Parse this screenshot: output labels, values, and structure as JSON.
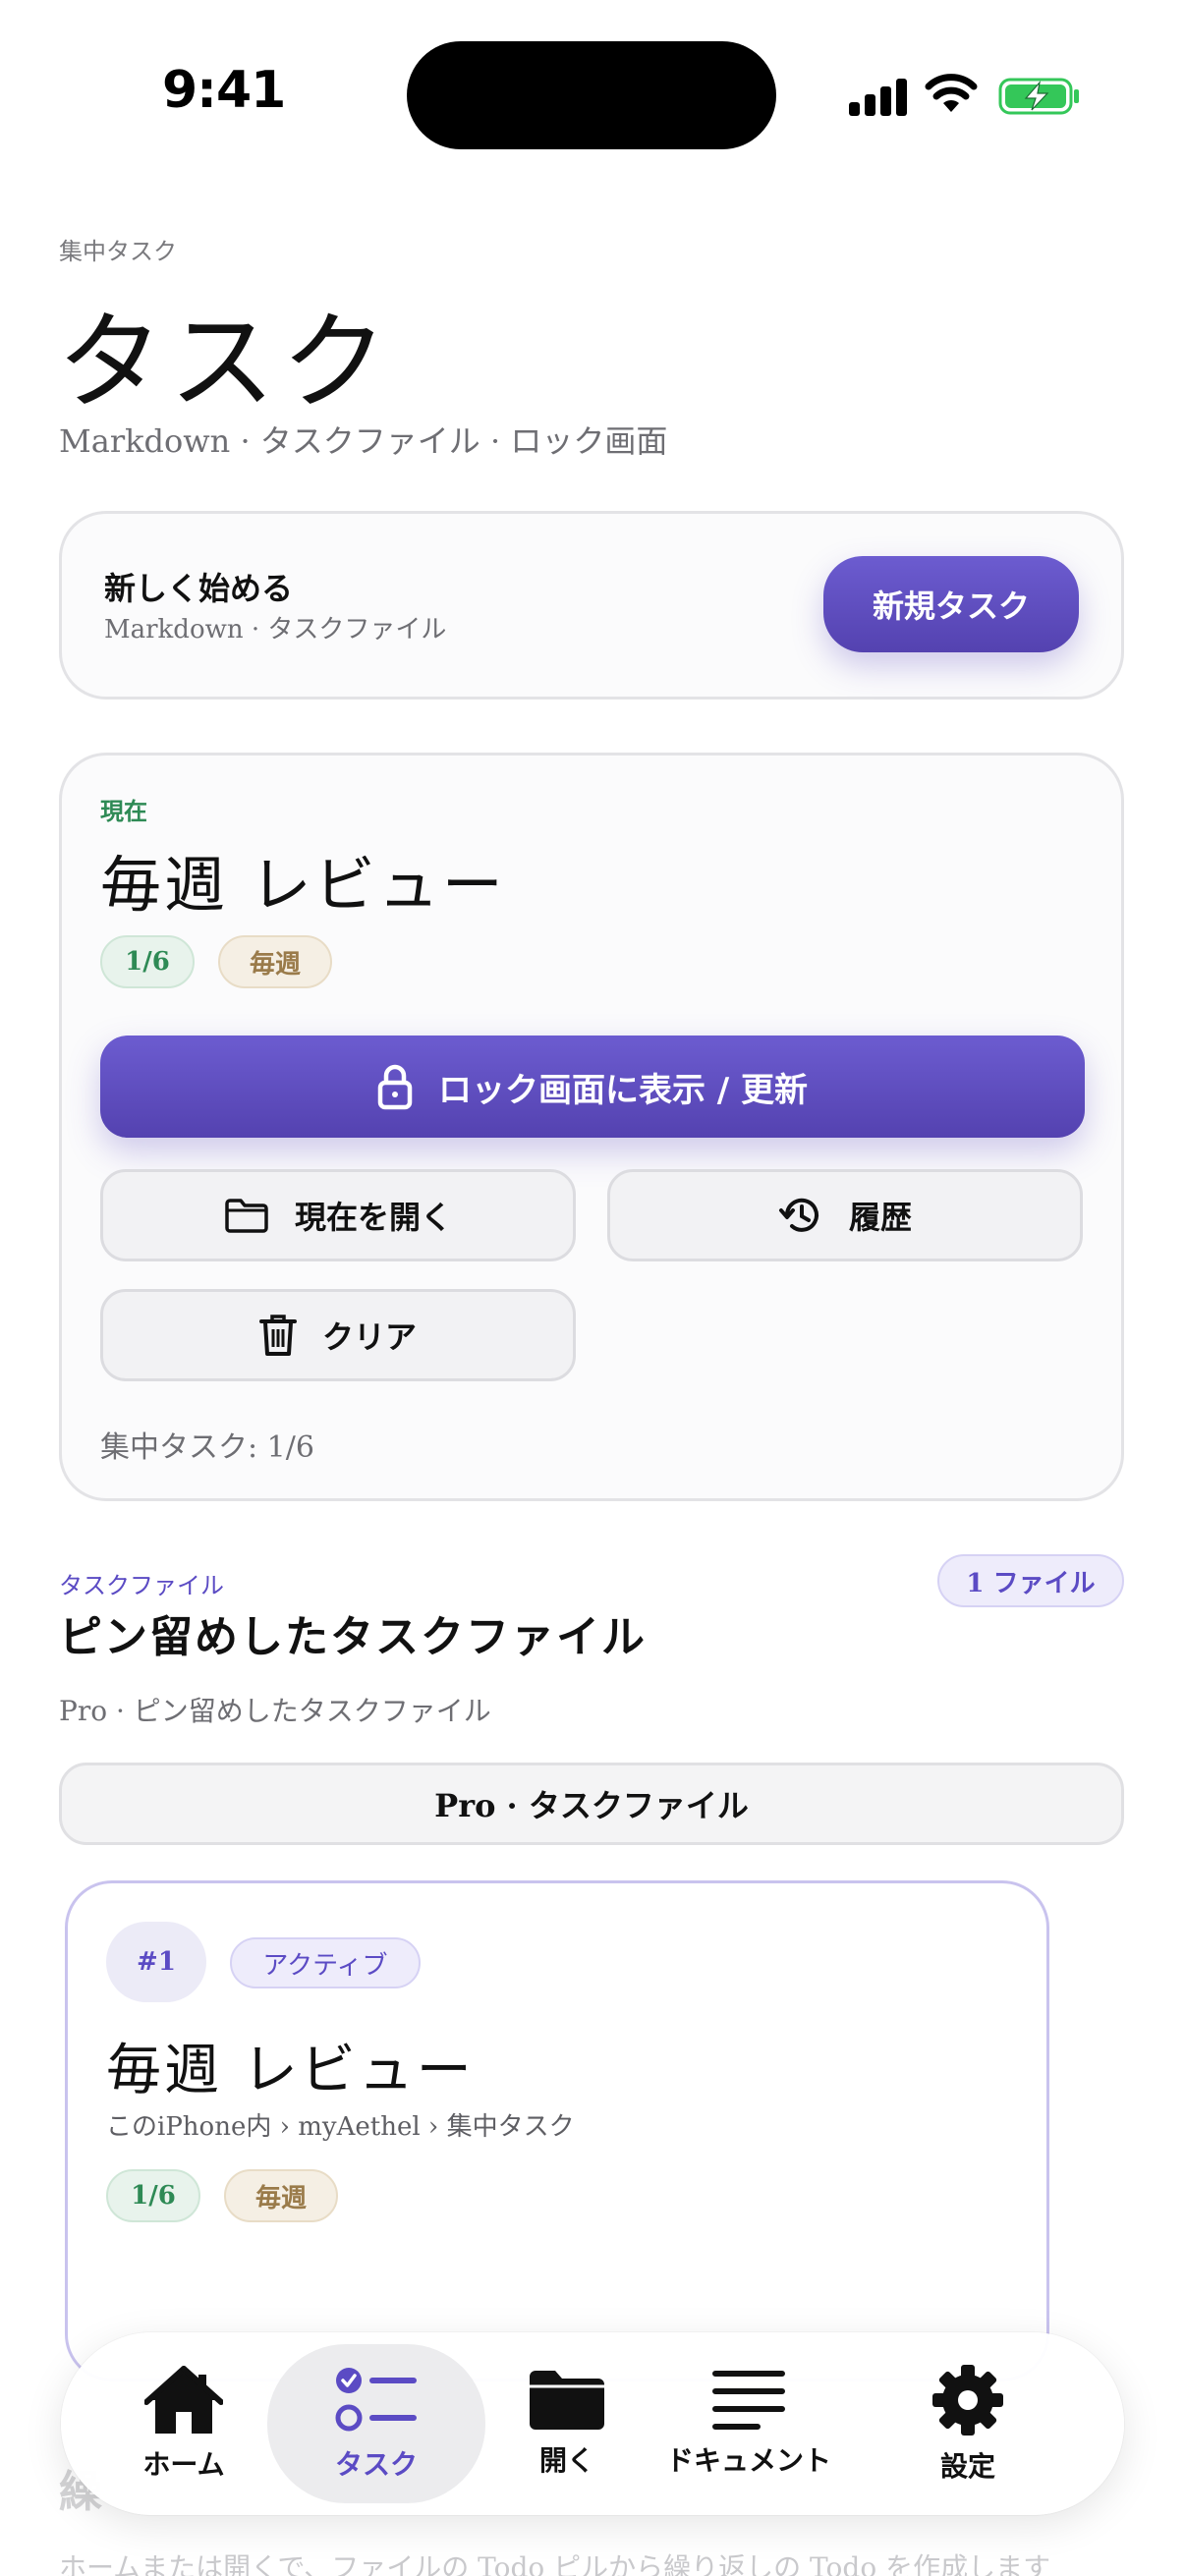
{
  "status_bar": {
    "time": "9:41"
  },
  "header": {
    "kicker": "集中タスク",
    "title": "タスク",
    "subtitle": "Markdown · タスクファイル · ロック画面"
  },
  "start_card": {
    "title": "新しく始める",
    "subtitle": "Markdown · タスクファイル",
    "new_task_button": "新規タスク"
  },
  "current": {
    "label": "現在",
    "title": "毎週 レビュー",
    "progress_badge": "1/6",
    "frequency_badge": "毎週",
    "lock_button": "ロック画面に表示 / 更新",
    "open_current_button": "現在を開く",
    "history_button": "履歴",
    "clear_button": "クリア",
    "focus_status": "集中タスク: 1/6"
  },
  "task_files": {
    "kicker": "タスクファイル",
    "count_badge": "1 ファイル",
    "title": "ピン留めしたタスクファイル",
    "subtitle": "Pro · ピン留めしたタスクファイル",
    "pro_button": "Pro · タスクファイル",
    "files": [
      {
        "number": "#1",
        "state": "アクティブ",
        "title": "毎週 レビュー",
        "path": "このiPhone内 › myAethel › 集中タスク",
        "progress": "1/6",
        "frequency": "毎週"
      }
    ]
  },
  "below": {
    "title_fragment": "繰",
    "text": "ホームまたは開くで、ファイルの Todo ピルから繰り返しの Todo を作成します"
  },
  "tab_bar": {
    "active": "tasks",
    "items": [
      {
        "id": "home",
        "label": "ホーム",
        "icon": "house-icon"
      },
      {
        "id": "tasks",
        "label": "タスク",
        "icon": "checklist-icon"
      },
      {
        "id": "open",
        "label": "開く",
        "icon": "folder-icon"
      },
      {
        "id": "documents",
        "label": "ドキュメント",
        "icon": "text-lines-icon"
      },
      {
        "id": "settings",
        "label": "設定",
        "icon": "gear-icon"
      }
    ]
  },
  "colors": {
    "accent": "#5b4bc4",
    "green": "#2e8a55",
    "tan": "#9a7b4a",
    "battery": "#34c759"
  }
}
